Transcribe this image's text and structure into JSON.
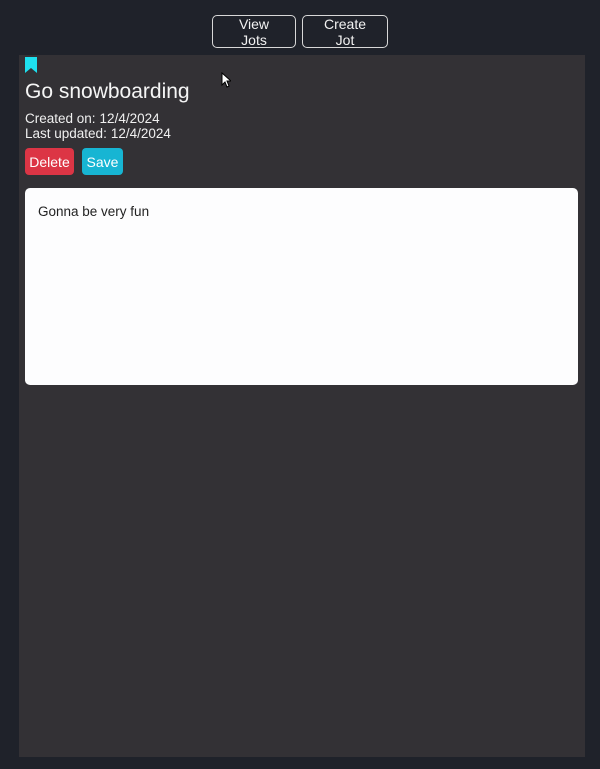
{
  "nav": {
    "view_jots_label": "View Jots",
    "create_jot_label": "Create Jot"
  },
  "jot": {
    "title": "Go snowboarding",
    "created_label": "Created on:",
    "created_date": "12/4/2024",
    "updated_label": "Last updated:",
    "updated_date": "12/4/2024",
    "content": "Gonna be very fun"
  },
  "actions": {
    "delete_label": "Delete",
    "save_label": "Save"
  },
  "icons": {
    "bookmark": "bookmark-icon",
    "cursor": "mouse-pointer-icon"
  },
  "colors": {
    "page_background": "#1f222a",
    "panel_background": "#333135",
    "delete_button": "#dc3545",
    "save_button": "#17b5d3",
    "bookmark": "#1ee0ef",
    "note_background": "#fdfdfe"
  }
}
